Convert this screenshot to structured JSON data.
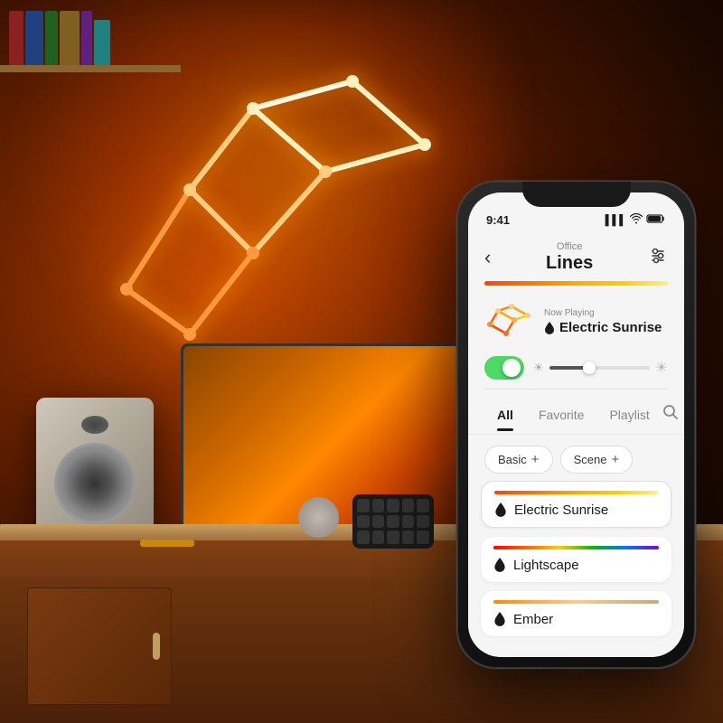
{
  "room": {
    "description": "Office room with Nanoleaf Lines on wall"
  },
  "phone": {
    "status_bar": {
      "time": "9:41",
      "signal": "▌▌▌",
      "wifi": "WiFi",
      "battery": "🔋"
    },
    "header": {
      "back_label": "‹",
      "subtitle": "Office",
      "title": "Lines",
      "settings_icon": "⚙"
    },
    "now_playing": {
      "label": "Now Playing",
      "scene_name": "Electric Sunrise",
      "color_bar": "orange-gradient"
    },
    "controls": {
      "toggle_on": true,
      "brightness_percent": 40
    },
    "tabs": [
      {
        "label": "All",
        "active": true
      },
      {
        "label": "Favorite",
        "active": false
      },
      {
        "label": "Playlist",
        "active": false
      }
    ],
    "categories": [
      {
        "label": "Basic",
        "plus": true
      },
      {
        "label": "Scene",
        "plus": true
      }
    ],
    "scenes": [
      {
        "name": "Electric Sunrise",
        "bar_gradient": "linear-gradient(to right, #ff4400, #ff7700, #ffaa00, #ffcc00)",
        "active": true
      },
      {
        "name": "Lightscape",
        "bar_gradient": "linear-gradient(to right, #ff0000, #ff8800, #ffff00, #00cc00, #0088ff, #8800ff)",
        "active": false
      },
      {
        "name": "Ember",
        "bar_gradient": "linear-gradient(to right, #ff6600, #ffaa00, #ffdd88, #eecc88)",
        "active": false
      }
    ],
    "search_icon": "🔍",
    "back_icon": "‹",
    "settings_adjust_icon": "⚙"
  }
}
